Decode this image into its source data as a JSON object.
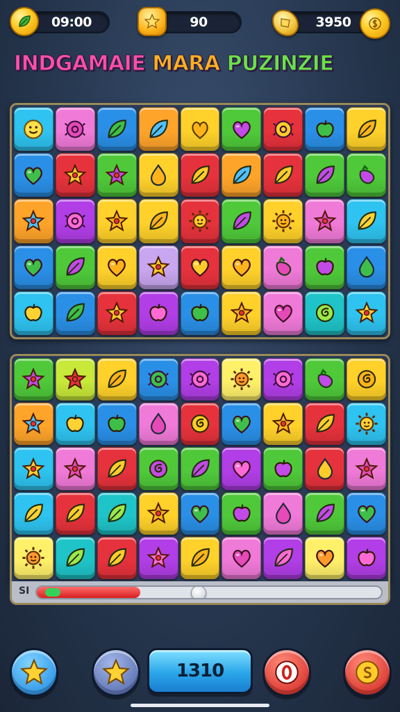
{
  "hud": {
    "timer": "09:00",
    "stars": "90",
    "coins": "3950"
  },
  "title": {
    "word1": "INDGAMAIE",
    "word2": "MARA",
    "word3": "PUZINZIE"
  },
  "progress": {
    "label": "SI",
    "level": 0.47
  },
  "buttons": {
    "center_label": "1310"
  },
  "colors": {
    "cyan": "#2ec3f0",
    "pink": "#f07ad8",
    "blue": "#2a8fe6",
    "orange": "#ffa42a",
    "yellow": "#ffd12a",
    "green": "#4fc93a",
    "purple": "#b13ee6",
    "red": "#e6323c",
    "lime": "#c8e83a",
    "lightyellow": "#fff06a",
    "lavender": "#c9a6f0",
    "teal": "#1fc4c8"
  },
  "board_top": [
    [
      [
        "cyan",
        "face"
      ],
      [
        "pink",
        "bug"
      ],
      [
        "blue",
        "leaf"
      ],
      [
        "orange",
        "leaf"
      ],
      [
        "yellow",
        "heart-leaf"
      ],
      [
        "green",
        "heart"
      ],
      [
        "red",
        "bug"
      ],
      [
        "blue",
        "apple"
      ],
      [
        "yellow",
        "leaf"
      ]
    ],
    [
      [
        "blue",
        "heart"
      ],
      [
        "red",
        "star"
      ],
      [
        "green",
        "star"
      ],
      [
        "yellow",
        "drop"
      ],
      [
        "red",
        "leaf"
      ],
      [
        "orange",
        "leaf"
      ],
      [
        "red",
        "leaf"
      ],
      [
        "green",
        "leaf"
      ],
      [
        "green",
        "pepper"
      ]
    ],
    [
      [
        "orange",
        "star"
      ],
      [
        "purple",
        "bug"
      ],
      [
        "yellow",
        "star"
      ],
      [
        "yellow",
        "leaf"
      ],
      [
        "red",
        "sun"
      ],
      [
        "green",
        "leaf"
      ],
      [
        "yellow",
        "sun"
      ],
      [
        "pink",
        "star"
      ],
      [
        "cyan",
        "leaf"
      ]
    ],
    [
      [
        "blue",
        "heart"
      ],
      [
        "green",
        "leaf"
      ],
      [
        "yellow",
        "heart"
      ],
      [
        "lavender",
        "star"
      ],
      [
        "red",
        "heart"
      ],
      [
        "yellow",
        "heart"
      ],
      [
        "pink",
        "pepper"
      ],
      [
        "green",
        "apple"
      ],
      [
        "blue",
        "drop"
      ]
    ],
    [
      [
        "cyan",
        "apple"
      ],
      [
        "blue",
        "leaf"
      ],
      [
        "red",
        "star"
      ],
      [
        "purple",
        "apple"
      ],
      [
        "blue",
        "apple"
      ],
      [
        "yellow",
        "star"
      ],
      [
        "pink",
        "heart"
      ],
      [
        "teal",
        "swirl"
      ],
      [
        "cyan",
        "star"
      ]
    ]
  ],
  "board_bottom": [
    [
      [
        "green",
        "star"
      ],
      [
        "lime",
        "star"
      ],
      [
        "yellow",
        "leaf"
      ],
      [
        "blue",
        "bug"
      ],
      [
        "purple",
        "bug"
      ],
      [
        "lightyellow",
        "sun"
      ],
      [
        "purple",
        "bug"
      ],
      [
        "green",
        "pepper"
      ],
      [
        "yellow",
        "swirl"
      ]
    ],
    [
      [
        "orange",
        "star"
      ],
      [
        "cyan",
        "apple"
      ],
      [
        "blue",
        "apple"
      ],
      [
        "pink",
        "drop"
      ],
      [
        "red",
        "swirl"
      ],
      [
        "blue",
        "heart"
      ],
      [
        "yellow",
        "star"
      ],
      [
        "red",
        "leaf"
      ],
      [
        "cyan",
        "sun"
      ]
    ],
    [
      [
        "cyan",
        "star"
      ],
      [
        "pink",
        "star"
      ],
      [
        "red",
        "leaf"
      ],
      [
        "green",
        "swirl"
      ],
      [
        "green",
        "leaf"
      ],
      [
        "purple",
        "heart"
      ],
      [
        "green",
        "apple"
      ],
      [
        "red",
        "drop"
      ],
      [
        "pink",
        "star"
      ]
    ],
    [
      [
        "cyan",
        "leaf"
      ],
      [
        "red",
        "leaf"
      ],
      [
        "teal",
        "leaf"
      ],
      [
        "yellow",
        "star"
      ],
      [
        "blue",
        "heart"
      ],
      [
        "green",
        "apple"
      ],
      [
        "pink",
        "drop"
      ],
      [
        "green",
        "leaf"
      ],
      [
        "blue",
        "heart"
      ]
    ],
    [
      [
        "lightyellow",
        "sun"
      ],
      [
        "teal",
        "leaf"
      ],
      [
        "red",
        "leaf"
      ],
      [
        "purple",
        "star"
      ],
      [
        "yellow",
        "leaf"
      ],
      [
        "pink",
        "heart"
      ],
      [
        "purple",
        "leaf"
      ],
      [
        "lightyellow",
        "heart"
      ],
      [
        "purple",
        "apple"
      ]
    ]
  ]
}
